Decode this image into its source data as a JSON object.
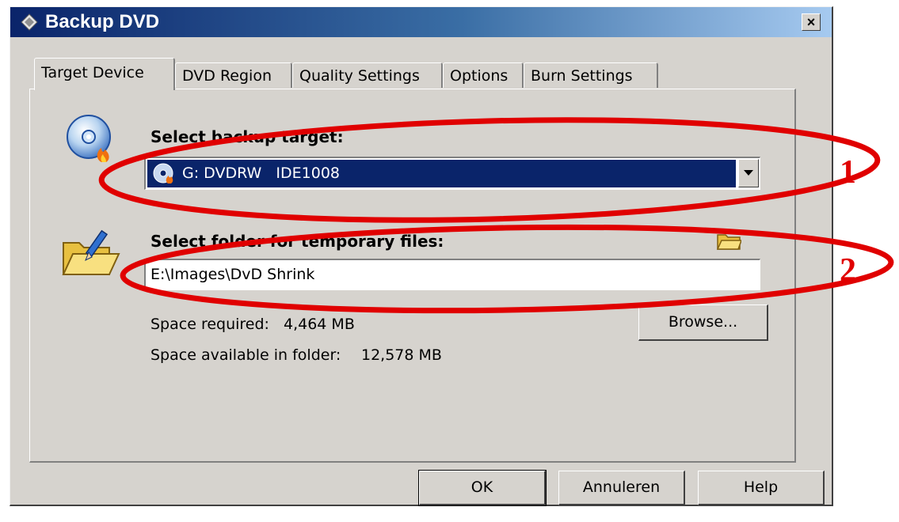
{
  "window": {
    "title": "Backup DVD",
    "title_icon": "backup-dvd-icon",
    "close_label": "×"
  },
  "tabs": [
    {
      "label": "Target Device",
      "active": true
    },
    {
      "label": "DVD Region",
      "active": false
    },
    {
      "label": "Quality Settings",
      "active": false
    },
    {
      "label": "Options",
      "active": false
    },
    {
      "label": "Burn Settings",
      "active": false
    }
  ],
  "target": {
    "label": "Select backup target:",
    "selected_device": "G: DVDRW   IDE1008",
    "icon": "dvd-burn-icon"
  },
  "temp_folder": {
    "label": "Select folder for temporary files:",
    "path": "E:\\Images\\DvD Shrink",
    "space_required_label": "Space required:",
    "space_required_value": "4,464 MB",
    "space_available_label": "Space available in folder:",
    "space_available_value": "12,578 MB",
    "browse_label": "Browse..."
  },
  "buttons": {
    "ok": "OK",
    "cancel": "Annuleren",
    "help": "Help"
  },
  "annotations": [
    {
      "number": "1",
      "color": "#e00000"
    },
    {
      "number": "2",
      "color": "#e00000"
    }
  ]
}
